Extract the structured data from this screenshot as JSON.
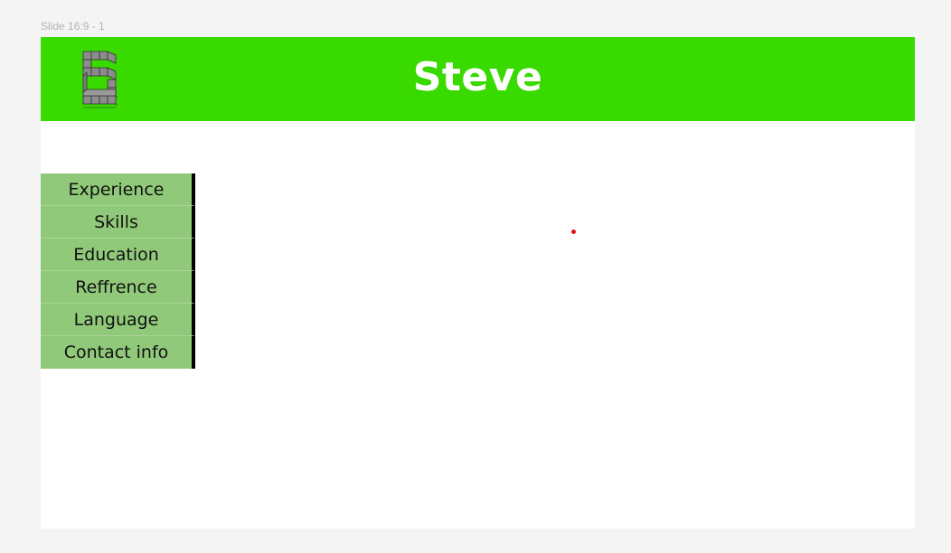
{
  "frame": {
    "label": "Slide 16:9 - 1"
  },
  "header": {
    "title": "Steve",
    "logo_icon": "letter-s-block-logo",
    "background": "#38da00"
  },
  "nav": {
    "items": [
      {
        "label": "Experience"
      },
      {
        "label": "Skills"
      },
      {
        "label": "Education"
      },
      {
        "label": "Reffrence"
      },
      {
        "label": "Language"
      },
      {
        "label": "Contact info"
      }
    ],
    "background": "#91c97a",
    "border_color": "#000000"
  },
  "marker": {
    "icon": "red-dot",
    "color": "#e01010"
  }
}
